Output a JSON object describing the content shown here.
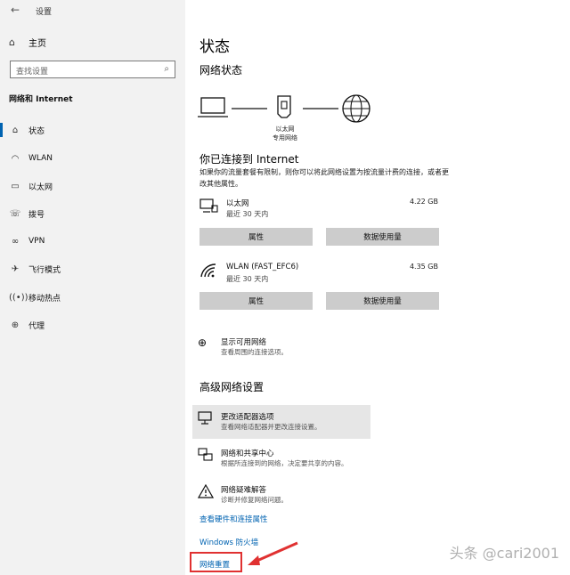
{
  "window": {
    "title": "设置"
  },
  "sidebar": {
    "home": "主页",
    "search_placeholder": "查找设置",
    "section": "网络和 Internet",
    "items": [
      {
        "label": "状态",
        "icon": "home-status-icon"
      },
      {
        "label": "WLAN",
        "icon": "wifi-icon"
      },
      {
        "label": "以太网",
        "icon": "ethernet-icon"
      },
      {
        "label": "拨号",
        "icon": "dialup-icon"
      },
      {
        "label": "VPN",
        "icon": "vpn-icon"
      },
      {
        "label": "飞行模式",
        "icon": "airplane-icon"
      },
      {
        "label": "移动热点",
        "icon": "hotspot-icon"
      },
      {
        "label": "代理",
        "icon": "globe-icon"
      }
    ]
  },
  "main": {
    "title": "状态",
    "network_status": "网络状态",
    "ethernet_label": "以太网",
    "ethernet_sub": "专用网络",
    "connected_title": "你已连接到 Internet",
    "connected_desc": "如果你的流量套餐有限制，则你可以将此网络设置为按流量计费的连接，或者更改其他属性。",
    "connections": [
      {
        "name": "以太网",
        "since": "最近 30 天内",
        "size": "4.22 GB",
        "btn_properties": "属性",
        "btn_usage": "数据使用量"
      },
      {
        "name": "WLAN (FAST_EFC6)",
        "since": "最近 30 天内",
        "size": "4.35 GB",
        "btn_properties": "属性",
        "btn_usage": "数据使用量"
      }
    ],
    "show_networks": {
      "title": "显示可用网络",
      "desc": "查看周围的连接选项。"
    },
    "advanced_title": "高级网络设置",
    "adapter": {
      "title": "更改适配器选项",
      "desc": "查看网络适配器并更改连接设置。"
    },
    "sharing": {
      "title": "网络和共享中心",
      "desc": "根据所连接到的网络，决定要共享的内容。"
    },
    "troubleshoot": {
      "title": "网络疑难解答",
      "desc": "诊断并修复网络问题。"
    },
    "link_hardware": "查看硬件和连接属性",
    "link_firewall": "Windows 防火墙",
    "link_reset": "网络重置"
  },
  "watermark": "头条 @cari2001",
  "colors": {
    "accent": "#0063b1",
    "annotation": "#e03131"
  }
}
